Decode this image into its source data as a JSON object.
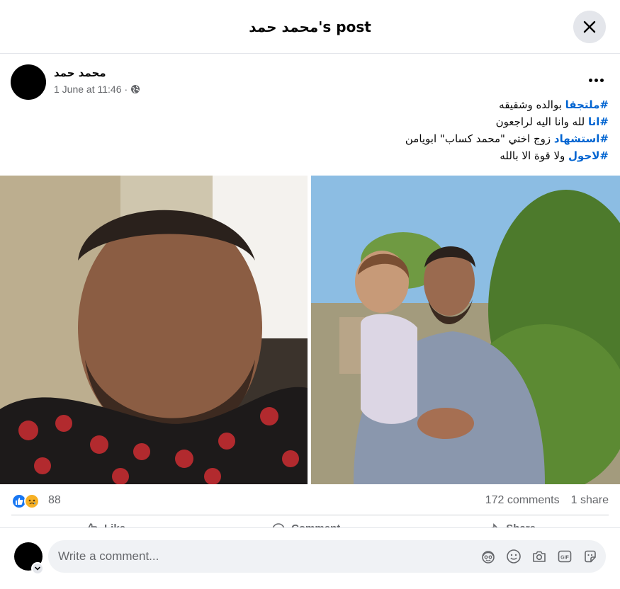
{
  "header": {
    "title": "محمد حمد's post"
  },
  "post": {
    "author": "محمد حمد",
    "time": "1 June at 11:46",
    "separator": "·",
    "lines": [
      {
        "hashtag": "#ملتجقا",
        "text": " بوالده وشقيقه"
      },
      {
        "hashtag": "#انا",
        "text": " لله وانا اليه لراجعون"
      },
      {
        "hashtag": "#استشهاد",
        "text": " زوج اختي \"محمد كساب\" ابويامن"
      },
      {
        "hashtag": "#لاحول",
        "text": " ولا قوة الا بالله"
      }
    ]
  },
  "stats": {
    "reaction_count": "88",
    "comments": "172 comments",
    "shares": "1 share"
  },
  "actions": {
    "like": "Like",
    "comment": "Comment",
    "share": "Share"
  },
  "comment_bar": {
    "placeholder": "Write a comment..."
  },
  "colors": {
    "hashtag": "#0064d1",
    "like_blue": "#1877f2",
    "sad_yellow": "#f7b125",
    "secondary_text": "#65676b"
  },
  "icons": {
    "close": "close-icon",
    "privacy": "globe-icon",
    "more": "more-options-icon",
    "like_reaction": "like-reaction-icon",
    "sad_reaction": "sad-reaction-icon",
    "avatar_sticker": "avatar-sticker-icon",
    "emoji": "emoji-icon",
    "camera": "camera-icon",
    "gif": "gif-icon",
    "sticker": "sticker-icon"
  }
}
